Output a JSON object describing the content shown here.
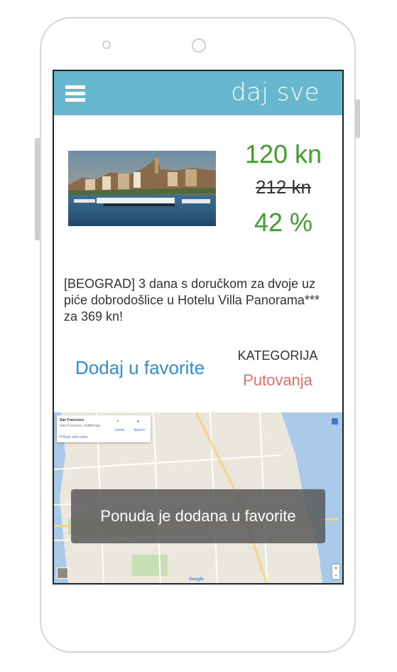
{
  "app": {
    "brand": "daj sve",
    "accent": "#67b8ce"
  },
  "deal": {
    "image_icon": "city-photo",
    "price_new": "120 kn",
    "price_old": "212 kn",
    "discount": "42 %",
    "description": "[BEOGRAD] 3 dana s doručkom za dvoje uz piće dobrodošlice u Hotelu Villa Panorama*** za 369 kn!",
    "favorite_label": "Dodaj u favorite",
    "category_label": "KATEGORIJA",
    "category_value": "Putovanja",
    "colors": {
      "price": "#3f9d2e",
      "link": "#2f8ed9",
      "category": "#e86b66"
    }
  },
  "map": {
    "card_title": "San Francisco",
    "card_sub": "San Francisco, Kalifornija",
    "card_link": "Prikaži veću kartu",
    "card_directions": "Upute",
    "card_save": "Spremi",
    "google": "Google",
    "zoom_in": "+",
    "zoom_out": "−"
  },
  "toast": {
    "message": "Ponuda je dodana u favorite"
  }
}
